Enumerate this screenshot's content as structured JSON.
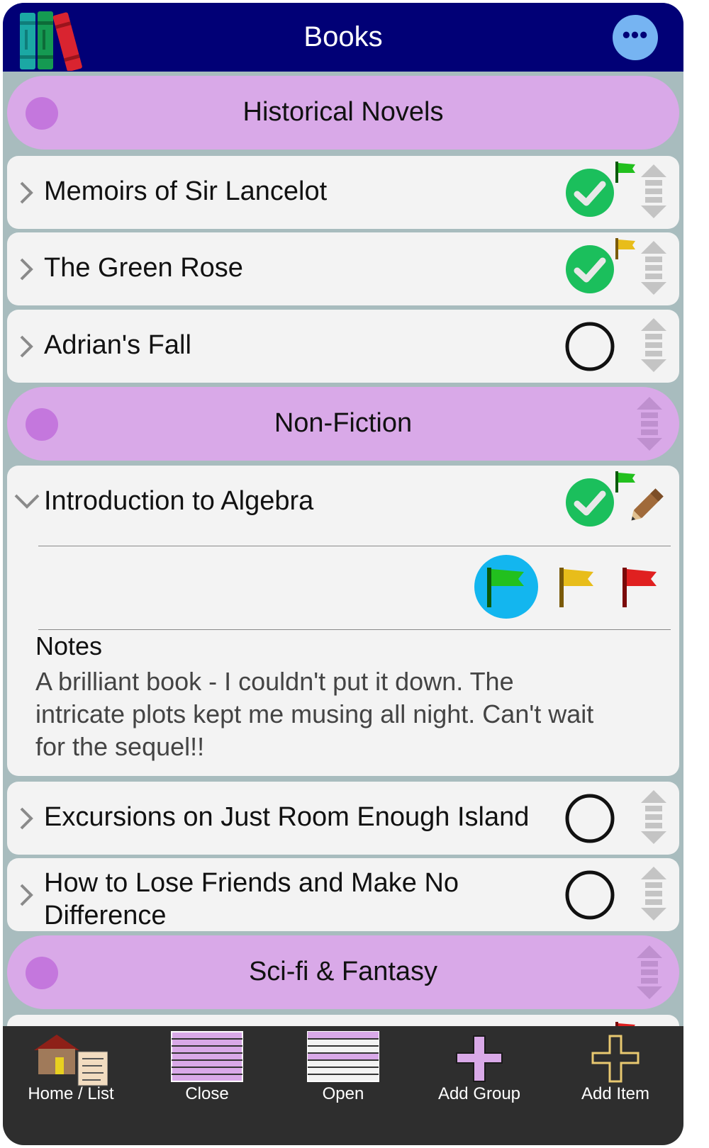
{
  "header": {
    "title": "Books",
    "menu_label": "•••"
  },
  "groups": [
    {
      "title": "Historical Novels"
    },
    {
      "title": "Non-Fiction"
    },
    {
      "title": "Sci-fi & Fantasy"
    }
  ],
  "items": [
    {
      "title": "Memoirs of Sir Lancelot",
      "done": true,
      "flag": "green"
    },
    {
      "title": "The Green Rose",
      "done": true,
      "flag": "yellow"
    },
    {
      "title": "Adrian's Fall",
      "done": false,
      "flag": "none"
    },
    {
      "title": "Introduction to Algebra",
      "done": true,
      "flag": "green",
      "expanded": true
    },
    {
      "title": "Excursions on Just Room Enough Island",
      "done": false,
      "flag": "none"
    },
    {
      "title": "How to Lose Friends and Make No Difference",
      "done": false,
      "flag": "none"
    }
  ],
  "detail": {
    "notes_label": "Notes",
    "notes_text": "A brilliant book - I couldn't put it down. The intricate plots kept me musing all night. Can't wait for the sequel!!",
    "flag_options": [
      "green",
      "yellow",
      "red"
    ],
    "selected_flag": "green"
  },
  "toolbar": {
    "home_list": "Home  /  List",
    "close": "Close",
    "open": "Open",
    "add_group": "Add  Group",
    "add_item": "Add  Item"
  },
  "colors": {
    "header_bg": "#010076",
    "group_bg": "#d9a9e8",
    "group_dot": "#c477dd",
    "item_bg": "#f3f3f3",
    "check_green": "#1bbf5c",
    "flag_green": "#22c01e",
    "flag_yellow": "#e8bd1a",
    "flag_red": "#e02020",
    "selection": "#13b6ef",
    "toolbar_bg": "#2e2e2e"
  }
}
